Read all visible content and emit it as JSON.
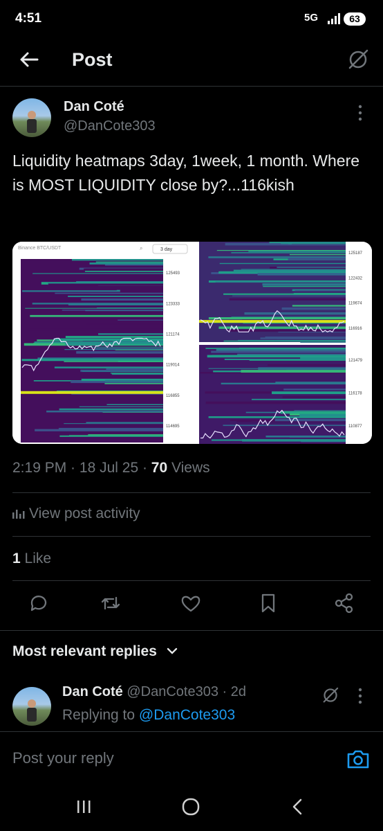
{
  "status": {
    "time": "4:51",
    "network": "5G",
    "battery": "63"
  },
  "header": {
    "title": "Post"
  },
  "post": {
    "author_name": "Dan Coté",
    "author_handle": "@DanCote303",
    "text": "Liquidity heatmaps 3day, 1week, 1 month. Where is MOST LIQUIDITY close by?...116kish",
    "image": {
      "pair": "Binance BTC/USDT",
      "range_selector": "3 day",
      "left_prices": [
        "125493",
        "123333",
        "121174",
        "119014",
        "116855",
        "114695"
      ],
      "top_right_prices": [
        "125187",
        "122432",
        "119674",
        "116916"
      ],
      "bottom_right_prices": [
        "121479",
        "116178",
        "110877"
      ]
    },
    "time": "2:19 PM",
    "date": "18 Jul 25",
    "views_count": "70",
    "views_label": "Views"
  },
  "view_activity": "View post activity",
  "likes": {
    "count": "1",
    "label": "Like"
  },
  "replies_sort": "Most relevant replies",
  "reply": {
    "author_name": "Dan Coté",
    "author_handle": "@DanCote303",
    "age": "2d",
    "replying_prefix": "Replying to",
    "replying_handle": "@DanCote303"
  },
  "composer": {
    "placeholder": "Post your reply"
  },
  "colors": {
    "accent": "#1d9bf0",
    "muted": "#71767b",
    "text": "#e7e9ea"
  }
}
